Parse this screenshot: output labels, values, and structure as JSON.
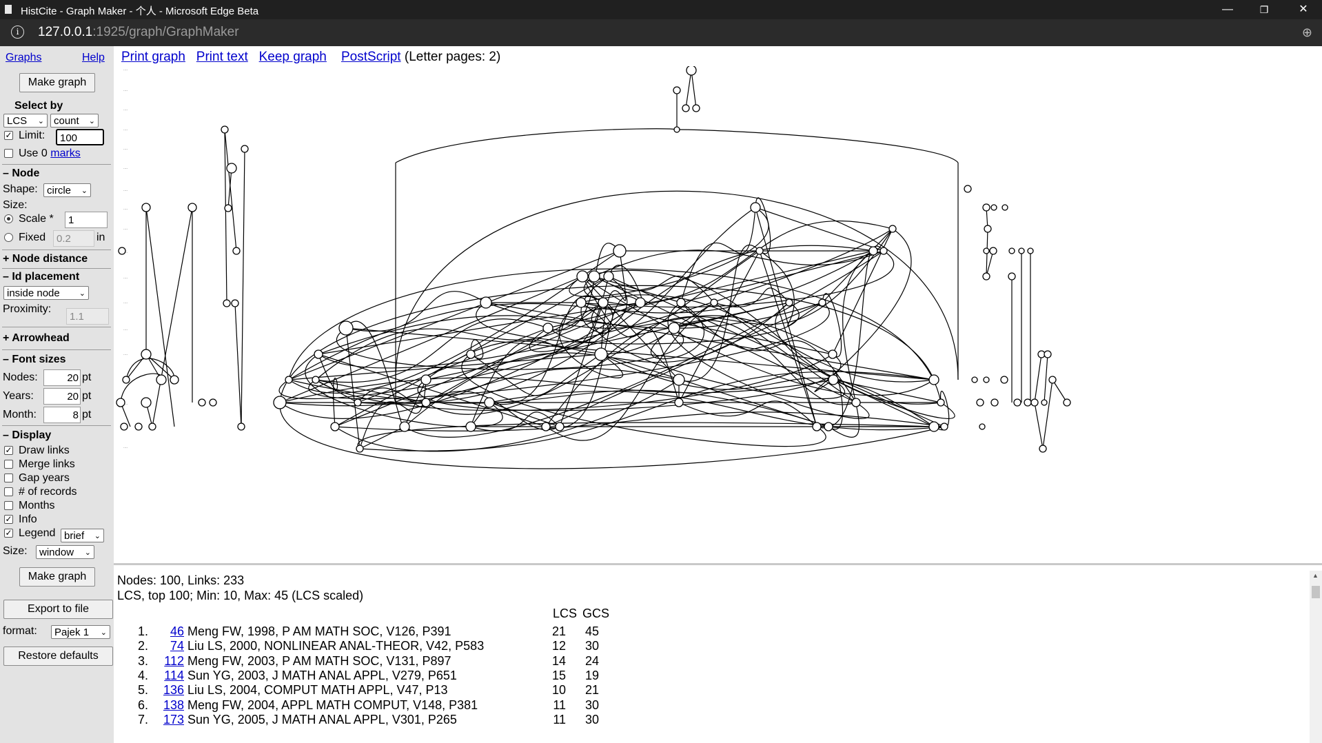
{
  "window": {
    "title": "HistCite - Graph Maker - 个人 - Microsoft Edge Beta",
    "minimize": "—",
    "maximize": "❐",
    "close": "✕"
  },
  "address": {
    "host": "127.0.0.1",
    "path": ":1925/graph/GraphMaker",
    "info_icon": "i",
    "zoom_icon": "⊕"
  },
  "sidebar": {
    "graphs_link": "Graphs",
    "help_link": "Help",
    "make_graph_top": "Make graph",
    "select_by_heading": "Select by",
    "select_by_metric": "LCS",
    "select_by_mode": "count",
    "limit_label": "Limit:",
    "limit_value": "100",
    "use_label": "Use 0",
    "marks_link": "marks",
    "node_heading": "– Node",
    "shape_label": "Shape:",
    "shape_value": "circle",
    "size_label": "Size:",
    "scale_label": "Scale *",
    "scale_value": "1",
    "fixed_label": "Fixed",
    "fixed_value": "0.2",
    "fixed_unit": "in",
    "node_distance_heading": "+ Node distance",
    "id_placement_heading": "– Id placement",
    "id_placement_value": "inside node",
    "proximity_label": "Proximity:",
    "proximity_value": "1.1",
    "arrowhead_heading": "+ Arrowhead",
    "font_sizes_heading": "– Font sizes",
    "nodes_label": "Nodes:",
    "nodes_value": "20",
    "years_label": "Years:",
    "years_value": "20",
    "month_label": "Month:",
    "month_value": "8",
    "pt_unit": "pt",
    "display_heading": "– Display",
    "draw_links": "Draw links",
    "merge_links": "Merge links",
    "gap_years": "Gap years",
    "num_records": "# of records",
    "months": "Months",
    "info": "Info",
    "legend": "Legend",
    "legend_value": "brief",
    "size_label2": "Size:",
    "size_value": "window",
    "make_graph_bottom": "Make graph",
    "export_button": "Export to file",
    "format_label": "format:",
    "format_value": "Pajek 1",
    "restore_button": "Restore defaults",
    "checkmark": "✓",
    "caret": "⌄"
  },
  "toolbar": {
    "print_graph": "Print graph",
    "print_text": "Print text",
    "keep_graph": "Keep graph",
    "postscript": "PostScript",
    "letter_pages": "(Letter pages: 2)"
  },
  "info": {
    "summary1": "Nodes: 100, Links: 233",
    "summary2": "LCS, top 100; Min: 10, Max: 45 (LCS scaled)",
    "col_lcs": "LCS",
    "col_gcs": "GCS",
    "rows": [
      {
        "n": "1.",
        "id": "46",
        "ref": "Meng FW, 1998, P AM MATH SOC, V126, P391",
        "lcs": "21",
        "gcs": "45"
      },
      {
        "n": "2.",
        "id": "74",
        "ref": "Liu LS, 2000, NONLINEAR ANAL-THEOR, V42, P583",
        "lcs": "12",
        "gcs": "30"
      },
      {
        "n": "3.",
        "id": "112",
        "ref": "Meng FW, 2003, P AM MATH SOC, V131, P897",
        "lcs": "14",
        "gcs": "24"
      },
      {
        "n": "4.",
        "id": "114",
        "ref": "Sun YG, 2003, J MATH ANAL APPL, V279, P651",
        "lcs": "15",
        "gcs": "19"
      },
      {
        "n": "5.",
        "id": "136",
        "ref": "Liu LS, 2004, COMPUT MATH APPL, V47, P13",
        "lcs": "10",
        "gcs": "21"
      },
      {
        "n": "6.",
        "id": "138",
        "ref": "Meng FW, 2004, APPL MATH COMPUT, V148, P381",
        "lcs": "11",
        "gcs": "30"
      },
      {
        "n": "7.",
        "id": "173",
        "ref": "Sun YG, 2005, J MATH ANAL APPL, V301, P265",
        "lcs": "11",
        "gcs": "30"
      }
    ]
  },
  "graph": {
    "node_count": 100,
    "link_count": 233
  }
}
